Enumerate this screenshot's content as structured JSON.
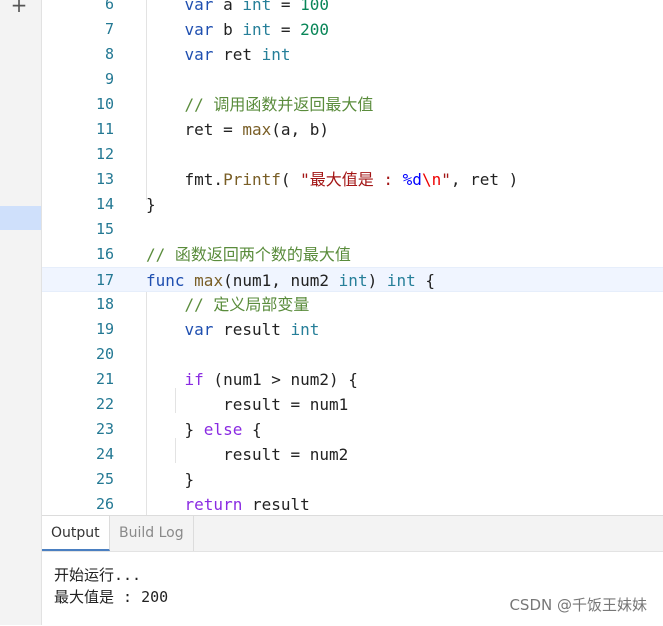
{
  "toolbar": {
    "add_label": "+"
  },
  "editor": {
    "lines": [
      {
        "n": "6",
        "t": [
          [
            "    ",
            ""
          ],
          [
            "var",
            "kw2"
          ],
          [
            " a ",
            ""
          ],
          [
            "int",
            "type"
          ],
          [
            " = ",
            ""
          ],
          [
            "100",
            "num"
          ]
        ]
      },
      {
        "n": "7",
        "t": [
          [
            "    ",
            ""
          ],
          [
            "var",
            "kw2"
          ],
          [
            " b ",
            ""
          ],
          [
            "int",
            "type"
          ],
          [
            " = ",
            ""
          ],
          [
            "200",
            "num"
          ]
        ]
      },
      {
        "n": "8",
        "t": [
          [
            "    ",
            ""
          ],
          [
            "var",
            "kw2"
          ],
          [
            " ret ",
            ""
          ],
          [
            "int",
            "type"
          ]
        ]
      },
      {
        "n": "9",
        "t": []
      },
      {
        "n": "10",
        "t": [
          [
            "    ",
            ""
          ],
          [
            "// 调用函数并返回最大值",
            "cm"
          ]
        ]
      },
      {
        "n": "11",
        "t": [
          [
            "    ret = ",
            ""
          ],
          [
            "max",
            "fn"
          ],
          [
            "(a, b)",
            ""
          ]
        ]
      },
      {
        "n": "12",
        "t": []
      },
      {
        "n": "13",
        "t": [
          [
            "    fmt.",
            ""
          ],
          [
            "Printf",
            "fn"
          ],
          [
            "( ",
            ""
          ],
          [
            "\"最大值是 : ",
            "str"
          ],
          [
            "%d",
            "fmt"
          ],
          [
            "\\n",
            "esc"
          ],
          [
            "\"",
            "str"
          ],
          [
            ", ret )",
            ""
          ]
        ]
      },
      {
        "n": "14",
        "t": [
          [
            "}",
            ""
          ]
        ]
      },
      {
        "n": "15",
        "t": []
      },
      {
        "n": "16",
        "t": [
          [
            "// 函数返回两个数的最大值",
            "cm"
          ]
        ]
      },
      {
        "n": "17",
        "t": [
          [
            "func",
            "kw2"
          ],
          [
            " ",
            ""
          ],
          [
            "max",
            "fn"
          ],
          [
            "(num1, num2 ",
            ""
          ],
          [
            "int",
            "type"
          ],
          [
            ") ",
            ""
          ],
          [
            "int",
            "type"
          ],
          [
            " {",
            ""
          ]
        ],
        "current": true
      },
      {
        "n": "18",
        "t": [
          [
            "    ",
            ""
          ],
          [
            "// 定义局部变量",
            "cm"
          ]
        ]
      },
      {
        "n": "19",
        "t": [
          [
            "    ",
            ""
          ],
          [
            "var",
            "kw2"
          ],
          [
            " result ",
            ""
          ],
          [
            "int",
            "type"
          ]
        ]
      },
      {
        "n": "20",
        "t": []
      },
      {
        "n": "21",
        "t": [
          [
            "    ",
            ""
          ],
          [
            "if",
            "kw"
          ],
          [
            " (num1 > num2) {",
            ""
          ]
        ]
      },
      {
        "n": "22",
        "t": [
          [
            "        result = num1",
            ""
          ]
        ]
      },
      {
        "n": "23",
        "t": [
          [
            "    } ",
            ""
          ],
          [
            "else",
            "kw"
          ],
          [
            " {",
            ""
          ]
        ]
      },
      {
        "n": "24",
        "t": [
          [
            "        result = num2",
            ""
          ]
        ]
      },
      {
        "n": "25",
        "t": [
          [
            "    }",
            ""
          ]
        ]
      },
      {
        "n": "26",
        "t": [
          [
            "    ",
            ""
          ],
          [
            "return",
            "kw"
          ],
          [
            " result",
            ""
          ]
        ]
      }
    ]
  },
  "panel": {
    "tabs": [
      {
        "label": "Output"
      },
      {
        "label": "Build Log"
      }
    ],
    "output_lines": [
      "开始运行...",
      "最大值是 : 200"
    ]
  },
  "watermark": "CSDN @千饭王妹妹"
}
